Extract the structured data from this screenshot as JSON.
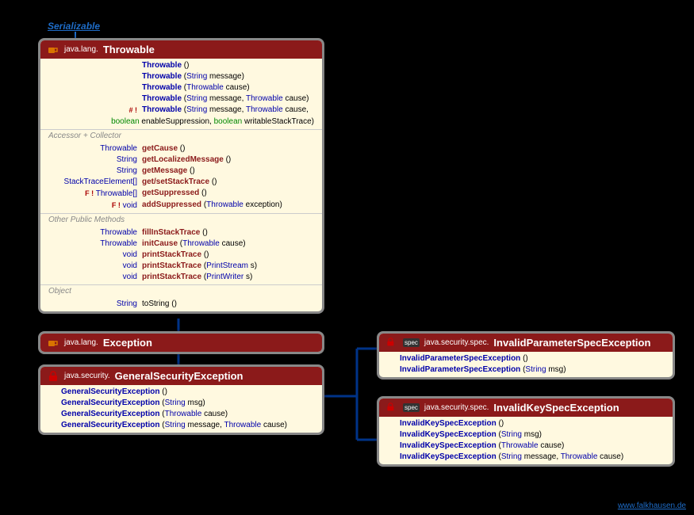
{
  "interface_label": "Serializable",
  "footer": "www.falkhausen.de",
  "throwable": {
    "pkg": "java.lang.",
    "name": "Throwable",
    "ctors": [
      {
        "name": "Throwable",
        "params": "()"
      },
      {
        "name": "Throwable",
        "params": "(String message)"
      },
      {
        "name": "Throwable",
        "params": "(Throwable cause)"
      },
      {
        "name": "Throwable",
        "params": "(String message, Throwable cause)"
      },
      {
        "mod": "# !",
        "name": "Throwable",
        "params": "(String message, Throwable cause,",
        "params2": "boolean enableSuppression, boolean writableStackTrace)"
      }
    ],
    "accessor_label": "Accessor + Collector",
    "accessors": [
      {
        "ret": "Throwable",
        "name": "getCause",
        "params": "()"
      },
      {
        "ret": "String",
        "name": "getLocalizedMessage",
        "params": "()"
      },
      {
        "ret": "String",
        "name": "getMessage",
        "params": "()"
      },
      {
        "ret": "StackTraceElement[]",
        "name": "get/setStackTrace",
        "params": "()"
      },
      {
        "mod": "F !",
        "ret": "Throwable[]",
        "name": "getSuppressed",
        "params": "()"
      },
      {
        "mod": "F !",
        "ret": "void",
        "name": "addSuppressed",
        "params": "(Throwable exception)"
      }
    ],
    "other_label": "Other Public Methods",
    "others": [
      {
        "ret": "Throwable",
        "name": "fillInStackTrace",
        "params": "()"
      },
      {
        "ret": "Throwable",
        "name": "initCause",
        "params": "(Throwable cause)"
      },
      {
        "ret": "void",
        "name": "printStackTrace",
        "params": "()"
      },
      {
        "ret": "void",
        "name": "printStackTrace",
        "params": "(PrintStream s)"
      },
      {
        "ret": "void",
        "name": "printStackTrace",
        "params": "(PrintWriter s)"
      }
    ],
    "object_label": "Object",
    "object_methods": [
      {
        "ret": "String",
        "name": "toString",
        "params": "()"
      }
    ]
  },
  "exception": {
    "pkg": "java.lang.",
    "name": "Exception"
  },
  "gse": {
    "pkg": "java.security.",
    "name": "GeneralSecurityException",
    "ctors": [
      {
        "name": "GeneralSecurityException",
        "params": "()"
      },
      {
        "name": "GeneralSecurityException",
        "params": "(String msg)"
      },
      {
        "name": "GeneralSecurityException",
        "params": "(Throwable cause)"
      },
      {
        "name": "GeneralSecurityException",
        "params": "(String message, Throwable cause)"
      }
    ]
  },
  "ipse": {
    "pkg": "java.security.spec.",
    "name": "InvalidParameterSpecException",
    "ctors": [
      {
        "name": "InvalidParameterSpecException",
        "params": "()"
      },
      {
        "name": "InvalidParameterSpecException",
        "params": "(String msg)"
      }
    ]
  },
  "ikse": {
    "pkg": "java.security.spec.",
    "name": "InvalidKeySpecException",
    "ctors": [
      {
        "name": "InvalidKeySpecException",
        "params": "()"
      },
      {
        "name": "InvalidKeySpecException",
        "params": "(String msg)"
      },
      {
        "name": "InvalidKeySpecException",
        "params": "(Throwable cause)"
      },
      {
        "name": "InvalidKeySpecException",
        "params": "(String message, Throwable cause)"
      }
    ]
  },
  "spec_badge": "spec"
}
